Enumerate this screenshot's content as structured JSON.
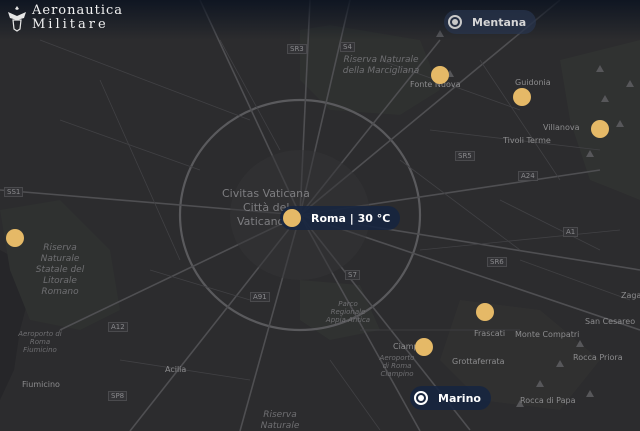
{
  "brand": {
    "line1": "Aeronautica",
    "line2": "Militare",
    "emblem": "eagle-emblem-icon"
  },
  "colors": {
    "marker": "#e5b967",
    "pill_bg": "#162440",
    "map_bg": "#2b2b2d"
  },
  "locations": {
    "mentana": "Mentana",
    "marino": "Marino",
    "roma": "Roma | 30 °C"
  },
  "places": {
    "civitas": "Civitas Vaticana",
    "citta": "Città del",
    "vaticano": "Vaticano",
    "guidonia": "Guidonia",
    "villanova": "Villanova",
    "fonte_nuova": "Fonte Nuova",
    "tivoli_terme": "Tivoli Terme",
    "frascati": "Frascati",
    "monte_compatri": "Monte Compatri",
    "san_cesareo": "San Cesareo",
    "grottaferrata": "Grottaferrata",
    "rocca_priora": "Rocca Priora",
    "rocca_di_papa": "Rocca di Papa",
    "ciampino": "Ciampino",
    "acilia": "Acilia",
    "fiumicino": "Fiumicino",
    "zagarolo": "Zaga",
    "marcigliana": "Riserva Naturale della Marcigliana",
    "litorale": "Riserva Naturale Statale del Litorale Romano",
    "appia": "Parco Regionale Appia Antica",
    "aeroporto_roma": "Aeroporto di Roma Fiumicino",
    "aeroporto_ciampino": "Aeroporto di Roma Ciampino",
    "riserva_bottom": "Riserva Naturale"
  },
  "roads": [
    "SS1",
    "SR3",
    "S4",
    "A24",
    "SR5",
    "SR6",
    "S7",
    "A91",
    "A12",
    "SP8",
    "A1",
    "A1"
  ]
}
